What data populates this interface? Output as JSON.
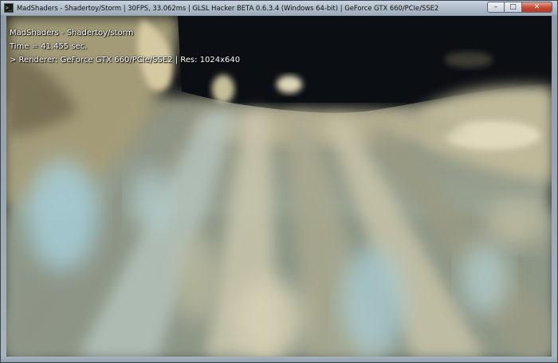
{
  "window": {
    "title": "MadShaders - Shadertoy/Storm | 30FPS, 33.062ms | GLSL Hacker BETA 0.6.3.4 (Windows 64-bit) | GeForce GTX 660/PCIe/SSE2",
    "icon": "terminal-icon",
    "controls": {
      "minimize": "–",
      "maximize": "□",
      "close": "✕"
    }
  },
  "overlay": {
    "line1": "MadShaders - Shadertoy/storm",
    "line2": "Time = 41.455 sec.",
    "line3": "> Renderer: GeForce GTX 660/PCIe/SSE2 | Res: 1024x640"
  },
  "colors": {
    "sky": "#0c1016",
    "cloud_light": "#d9d3b4",
    "cloud_mid": "#9c9a82",
    "cloud_blue": "#9fc2c8"
  }
}
